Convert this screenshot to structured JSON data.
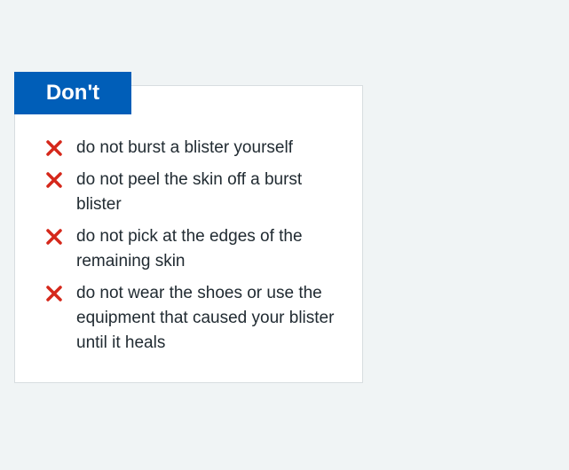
{
  "heading": "Don't",
  "colors": {
    "heading_background": "#005eb8",
    "heading_text": "#ffffff",
    "cross_icon": "#d5281b",
    "card_background": "#ffffff",
    "page_background": "#f0f4f5",
    "body_text": "#212b32"
  },
  "items": [
    {
      "icon": "cross-icon",
      "text": "do not burst a blister yourself"
    },
    {
      "icon": "cross-icon",
      "text": "do not peel the skin off a burst blister"
    },
    {
      "icon": "cross-icon",
      "text": "do not pick at the edges of the remaining skin"
    },
    {
      "icon": "cross-icon",
      "text": "do not wear the shoes or use the equipment that caused your blister until it heals"
    }
  ]
}
